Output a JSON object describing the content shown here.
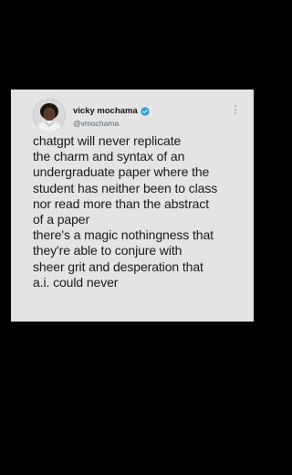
{
  "tweet": {
    "author": {
      "display_name": "vicky mochama",
      "handle": "@vmochama",
      "verified": true,
      "avatar_icon": "profile-photo"
    },
    "more_icon": "more-vertical-icon",
    "lines": [
      "chatgpt will never replicate",
      "the charm and syntax of an",
      "undergraduate paper where the",
      "student has neither been to class",
      "nor read more than the abstract",
      "of a paper",
      "there's a magic nothingness that",
      "they're able to conjure  with",
      "sheer grit and desperation that",
      "a.i. could never"
    ]
  },
  "colors": {
    "page_background": "#000000",
    "card_background": "#e4e4e4",
    "text": "#1a1a1a",
    "handle": "#5b6670",
    "verified": "#1d9bf0"
  }
}
